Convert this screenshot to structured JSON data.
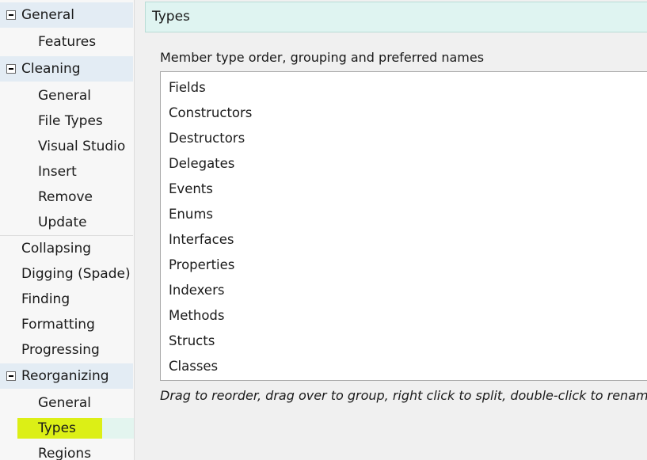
{
  "sidebar": {
    "general": {
      "label": "General",
      "children": [
        "Features"
      ]
    },
    "cleaning": {
      "label": "Cleaning",
      "children": [
        "General",
        "File Types",
        "Visual Studio",
        "Insert",
        "Remove",
        "Update"
      ]
    },
    "top_items": [
      "Collapsing",
      "Digging (Spade)",
      "Finding",
      "Formatting",
      "Progressing"
    ],
    "reorganizing": {
      "label": "Reorganizing",
      "children": [
        "General",
        "Types",
        "Regions"
      ]
    },
    "selected": "Types",
    "highlight_color": "#dcef16"
  },
  "panel": {
    "title": "Types",
    "list_label": "Member type order, grouping and preferred names",
    "items": [
      "Fields",
      "Constructors",
      "Destructors",
      "Delegates",
      "Events",
      "Enums",
      "Interfaces",
      "Properties",
      "Indexers",
      "Methods",
      "Structs",
      "Classes"
    ],
    "hint": "Drag to reorder, drag over to group, right click to split, double-click to rename"
  }
}
